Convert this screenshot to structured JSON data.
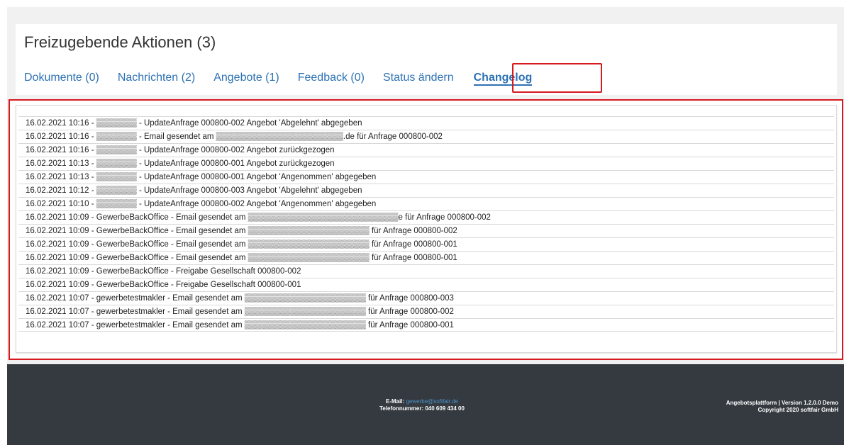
{
  "header": {
    "title": "Freizugebende Aktionen (3)"
  },
  "tabs": [
    {
      "label": "Dokumente (0)"
    },
    {
      "label": "Nachrichten (2)"
    },
    {
      "label": "Angebote (1)"
    },
    {
      "label": "Feedback (0)"
    },
    {
      "label": "Status ändern"
    },
    {
      "label": "Changelog",
      "active": true
    }
  ],
  "changelog": [
    "16.02.2021 10:16 - ▒▒▒▒▒▒▒ - UpdateAnfrage 000800-002 Angebot 'Abgelehnt' abgegeben",
    "16.02.2021 10:16 - ▒▒▒▒▒▒▒ - Email gesendet am ▒▒▒▒▒▒▒▒▒▒▒▒▒▒▒▒▒▒▒▒▒▒.de für Anfrage 000800-002",
    "16.02.2021 10:16 - ▒▒▒▒▒▒▒ - UpdateAnfrage 000800-002 Angebot zurückgezogen",
    "16.02.2021 10:13 - ▒▒▒▒▒▒▒ - UpdateAnfrage 000800-001 Angebot zurückgezogen",
    "16.02.2021 10:13 - ▒▒▒▒▒▒▒ - UpdateAnfrage 000800-001 Angebot 'Angenommen' abgegeben",
    "16.02.2021 10:12 - ▒▒▒▒▒▒▒ - UpdateAnfrage 000800-003 Angebot 'Abgelehnt' abgegeben",
    "16.02.2021 10:10 - ▒▒▒▒▒▒▒ - UpdateAnfrage 000800-002 Angebot 'Angenommen' abgegeben",
    "16.02.2021 10:09 - GewerbeBackOffice - Email gesendet am ▒▒▒▒▒▒▒▒▒▒▒▒▒▒▒▒▒▒▒▒▒▒▒▒▒▒e für Anfrage 000800-002",
    "16.02.2021 10:09 - GewerbeBackOffice - Email gesendet am ▒▒▒▒▒▒▒▒▒▒▒▒▒▒▒▒▒▒▒▒▒ für Anfrage 000800-002",
    "16.02.2021 10:09 - GewerbeBackOffice - Email gesendet am ▒▒▒▒▒▒▒▒▒▒▒▒▒▒▒▒▒▒▒▒▒ für Anfrage 000800-001",
    "16.02.2021 10:09 - GewerbeBackOffice - Email gesendet am ▒▒▒▒▒▒▒▒▒▒▒▒▒▒▒▒▒▒▒▒▒ für Anfrage 000800-001",
    "16.02.2021 10:09 - GewerbeBackOffice - Freigabe Gesellschaft 000800-002",
    "16.02.2021 10:09 - GewerbeBackOffice - Freigabe Gesellschaft 000800-001",
    "16.02.2021 10:07 - gewerbetestmakler - Email gesendet am ▒▒▒▒▒▒▒▒▒▒▒▒▒▒▒▒▒▒▒▒▒ für Anfrage 000800-003",
    "16.02.2021 10:07 - gewerbetestmakler - Email gesendet am ▒▒▒▒▒▒▒▒▒▒▒▒▒▒▒▒▒▒▒▒▒ für Anfrage 000800-002",
    "16.02.2021 10:07 - gewerbetestmakler - Email gesendet am ▒▒▒▒▒▒▒▒▒▒▒▒▒▒▒▒▒▒▒▒▒ für Anfrage 000800-001"
  ],
  "footer": {
    "email_label": "E-Mail:",
    "email": "gewerbe@softfair.de",
    "phone": "Telefonnummer: 040 609 434 00",
    "version": "Angebotsplattform | Version 1.2.0.0 Demo",
    "copyright": "Copyright 2020 softfair GmbH"
  },
  "colors": {
    "accent": "#2d72b3",
    "highlight": "#d71920",
    "footer_bg": "#343a40"
  }
}
